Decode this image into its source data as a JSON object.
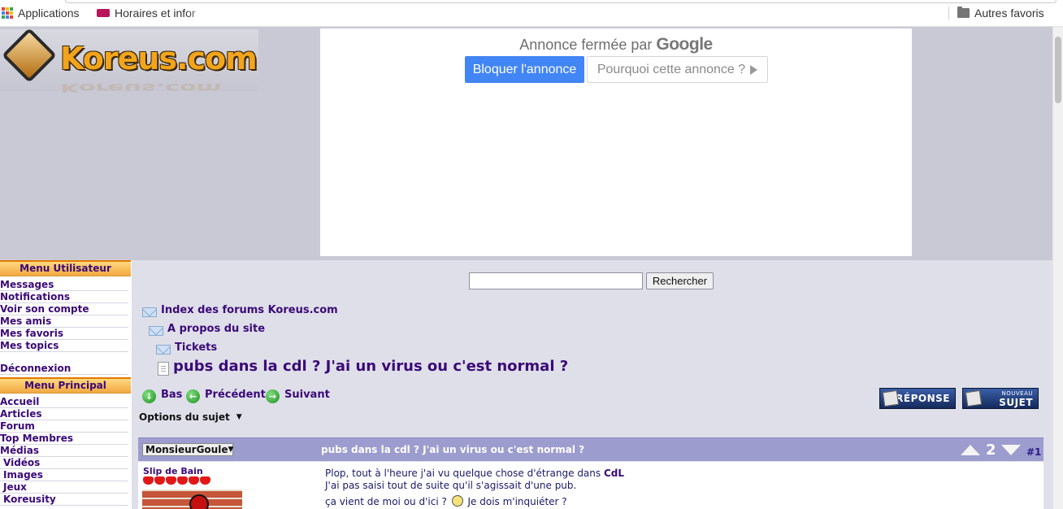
{
  "bookmarks": {
    "apps_label": "Applications",
    "horaires_label": "Horaires et infor",
    "other_label": "Autres favoris"
  },
  "logo": {
    "text": "Koreus.com"
  },
  "ad": {
    "closed_by": "Annonce fermée par",
    "google": "Google",
    "block_label": "Bloquer l'annonce",
    "why_label": "Pourquoi cette annonce ?"
  },
  "sidebar": {
    "user_menu_title": "Menu Utilisateur",
    "user_items": [
      "Messages",
      "Notifications",
      "Voir son compte",
      "Mes amis",
      "Mes favoris",
      "Mes topics"
    ],
    "logout": "Déconnexion",
    "main_menu_title": "Menu Principal",
    "main_items": [
      "Accueil",
      "Articles",
      "Forum",
      "Top Membres",
      "Médias"
    ],
    "media_items": [
      "Vidéos",
      "Images",
      "Jeux",
      "Koreusity"
    ]
  },
  "search": {
    "button_label": "Rechercher",
    "value": ""
  },
  "breadcrumb": {
    "index": "Index des forums Koreus.com",
    "about": "A propos du site",
    "tickets": "Tickets",
    "topic": "pubs dans la cdl ? J'ai un virus ou c'est normal ?"
  },
  "nav": {
    "bottom": "Bas",
    "previous": "Précédent",
    "next": "Suivant"
  },
  "options_label": "Options du sujet",
  "buttons": {
    "reply": "RÉPONSE",
    "new_small": "NOUVEAU",
    "new_main": "SUJET"
  },
  "post": {
    "author": "MonsieurGoule",
    "title": "pubs dans la cdl ? J'ai un virus ou c'est normal ?",
    "score": "2",
    "number": "#1",
    "rank": "Slip de Bain",
    "line1_text": "Plop, tout à l'heure j'ai vu quelque chose d'étrange dans ",
    "line1_bold": "CdL",
    "line2": "J'ai pas saisi tout de suite qu'il s'agissait d'une pub.",
    "line3_a": "ça vient de moi ou d'ici ?",
    "line3_b": "Je dois m'inquiéter ?"
  },
  "colors": {
    "accent": "#3a0a78",
    "menu_head": "#f2a840",
    "post_header": "#9c9cce",
    "google_blue": "#4285f4"
  }
}
